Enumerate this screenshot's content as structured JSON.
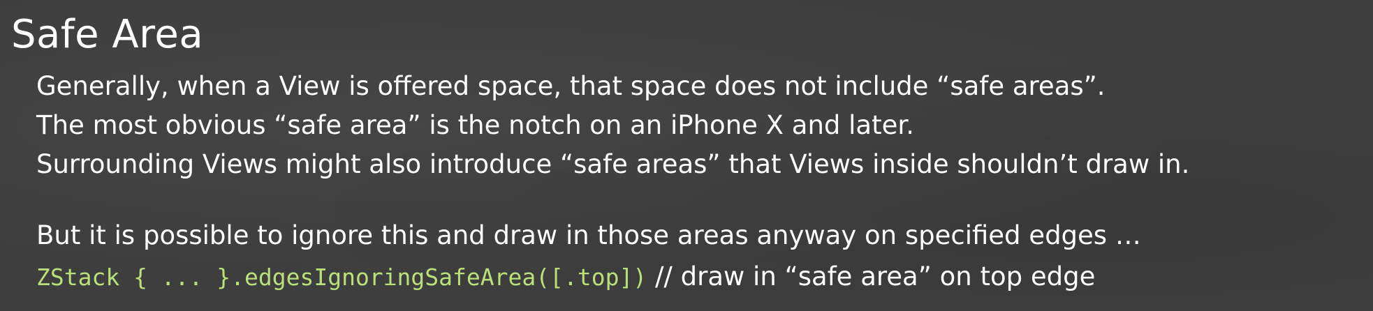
{
  "slide": {
    "title": "Safe Area",
    "bullets": [
      "Generally, when a View is offered space, that space does not include “safe areas”.",
      "The most obvious “safe area” is the notch on an iPhone X and later.",
      "Surrounding Views might also introduce “safe areas” that Views inside shouldn’t draw in."
    ],
    "note": "But it is possible to ignore this and draw in those areas anyway on specified edges …",
    "code": {
      "text": "ZStack { ... }.edgesIgnoringSafeArea([.top])",
      "comment": "// draw in “safe area” on top edge"
    }
  },
  "colors": {
    "background": "#3e3e3e",
    "text": "#ffffff",
    "code": "#b9e07a"
  }
}
